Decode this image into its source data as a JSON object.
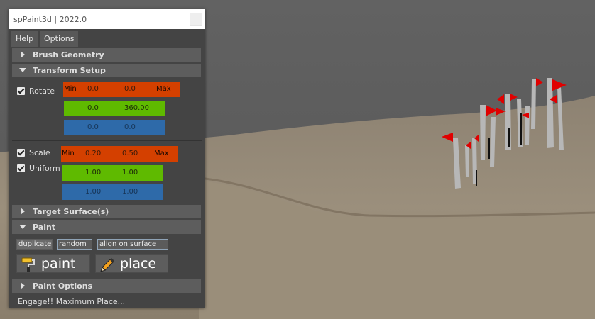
{
  "window": {
    "title": "spPaint3d | 2022.0"
  },
  "menu": {
    "items": [
      {
        "label": "Help"
      },
      {
        "label": "Options"
      }
    ]
  },
  "sections": {
    "brush_geometry": "Brush Geometry",
    "transform_setup": "Transform Setup",
    "target_surface": "Target Surface(s)",
    "paint": "Paint",
    "paint_options": "Paint Options"
  },
  "rotate": {
    "checkbox_label": "Rotate",
    "checked": true,
    "min_label": "Min",
    "max_label": "Max",
    "x": {
      "min": "0.0",
      "max": "0.0"
    },
    "y": {
      "min": "0.0",
      "max": "360.00"
    },
    "z": {
      "min": "0.0",
      "max": "0.0"
    }
  },
  "scale": {
    "checkbox_label": "Scale",
    "checked": true,
    "uniform_label": "Uniform",
    "uniform_checked": true,
    "min_label": "Min",
    "max_label": "Max",
    "x": {
      "min": "0.20",
      "max": "0.50"
    },
    "y": {
      "min": "1.00",
      "max": "1.00"
    },
    "z": {
      "min": "1.00",
      "max": "1.00"
    }
  },
  "paint": {
    "duplicate": "duplicate",
    "random": "random",
    "align_on_surface": "align on surface",
    "paint_button": "paint",
    "place_button": "place"
  },
  "status": "Engage!! Maximum Place...",
  "colors": {
    "red": "#d44000",
    "green": "#5fba00",
    "blue": "#2e6aa9",
    "panel": "#444444",
    "header": "#5d5d5d"
  }
}
